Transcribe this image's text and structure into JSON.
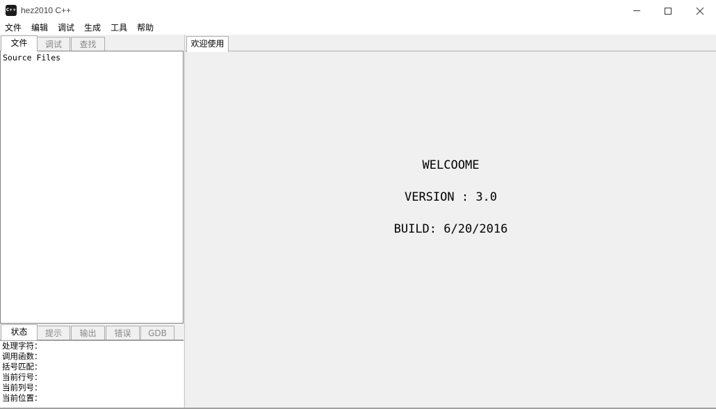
{
  "window": {
    "icon_text": "C++",
    "title": "hez2010 C++"
  },
  "menu": {
    "items": [
      "文件",
      "编辑",
      "调试",
      "生成",
      "工具",
      "帮助"
    ]
  },
  "left_tabs": {
    "items": [
      "文件",
      "调试",
      "查找"
    ],
    "active": 0
  },
  "file_tree": {
    "root": "Source Files"
  },
  "status_tabs": {
    "items": [
      "状态",
      "提示",
      "输出",
      "错误",
      "GDB"
    ],
    "active": 0
  },
  "status": {
    "lines": [
      "处理字符：",
      "调用函数：",
      "括号匹配：",
      "当前行号：",
      "当前列号：",
      "当前位置："
    ]
  },
  "editor_tabs": {
    "items": [
      "欢迎使用"
    ]
  },
  "welcome": {
    "line1": "WELCOOME",
    "line2": "VERSION : 3.0",
    "line3": "BUILD: 6/20/2016"
  }
}
